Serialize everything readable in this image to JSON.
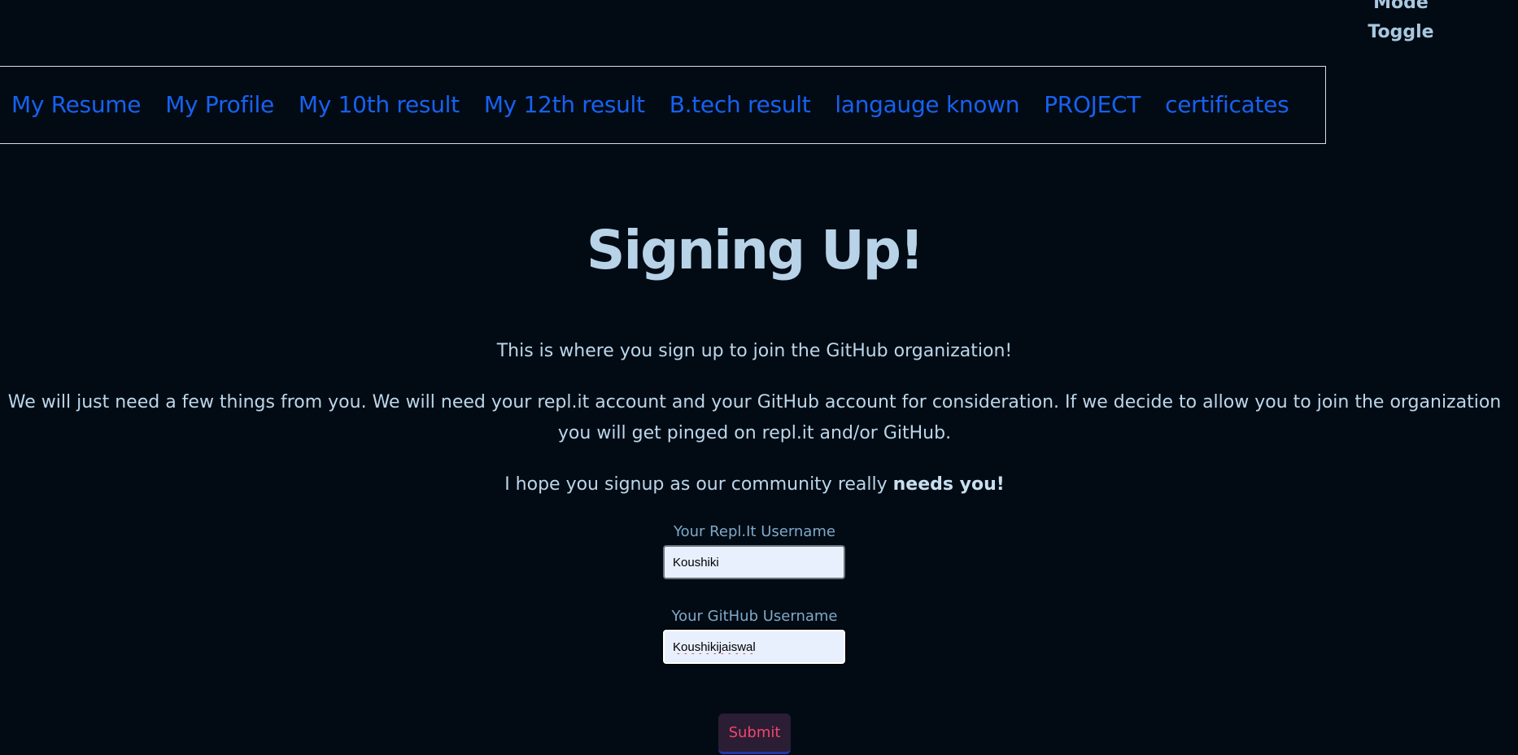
{
  "header": {
    "mode_toggle_line1": "Mode",
    "mode_toggle_line2": "Toggle"
  },
  "nav": {
    "items": [
      {
        "label": "My Resume"
      },
      {
        "label": "My Profile"
      },
      {
        "label": "My 10th result"
      },
      {
        "label": "My 12th result"
      },
      {
        "label": "B.tech result"
      },
      {
        "label": "langauge known"
      },
      {
        "label": "PROJECT"
      },
      {
        "label": "certificates"
      }
    ]
  },
  "main": {
    "title": "Signing Up!",
    "intro": "This is where you sign up to join the GitHub organization!",
    "details": "We will just need a few things from you. We will need your repl.it account and your GitHub account for consideration. If we decide to allow you to join the organization you will get pinged on repl.it and/or GitHub.",
    "closing_prefix": "I hope you signup as our community really ",
    "closing_emphasis": "needs you!"
  },
  "form": {
    "replit_label": "Your Repl.It Username",
    "replit_value": "Koushiki",
    "github_label": "Your GitHub Username",
    "github_value": "Koushikijaiswal",
    "submit_label": "Submit"
  },
  "colors": {
    "background": "#020b14",
    "nav_link": "#1761f0",
    "heading": "#b8d3e8",
    "submit_text": "#f0466f"
  }
}
